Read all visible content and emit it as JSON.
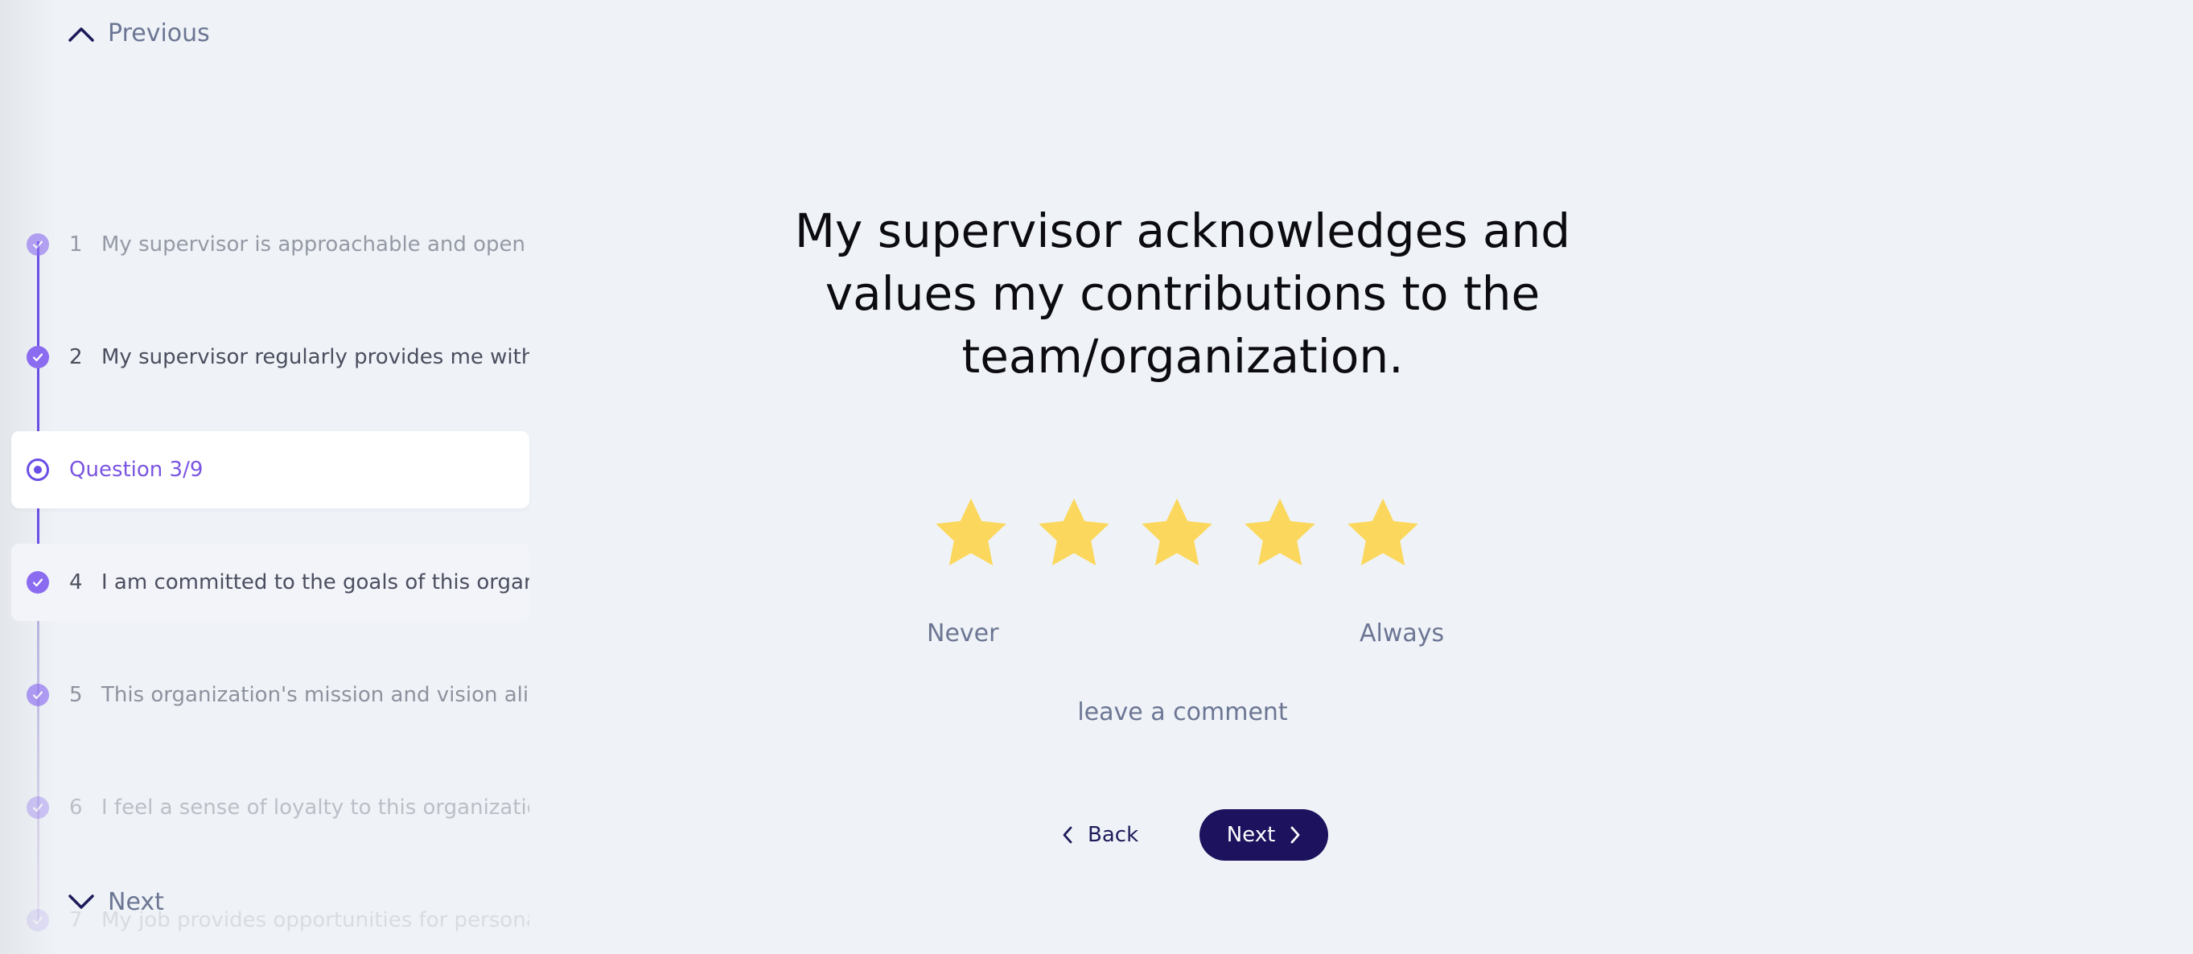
{
  "nav": {
    "previous_label": "Previous",
    "next_label": "Next"
  },
  "sidebar": {
    "current_label": "Question 3/9",
    "items": [
      {
        "number": "1",
        "text": "My supervisor is approachable and open to c",
        "status": "answered"
      },
      {
        "number": "2",
        "text": "My supervisor regularly provides me with cor",
        "status": "answered"
      },
      {
        "number": "3",
        "text": "",
        "status": "current"
      },
      {
        "number": "4",
        "text": "I am committed to the goals of this organiza",
        "status": "answered"
      },
      {
        "number": "5",
        "text": "This organization's mission and vision align v",
        "status": "answered"
      },
      {
        "number": "6",
        "text": "I feel a sense of loyalty to this organization's",
        "status": "answered"
      },
      {
        "number": "7",
        "text": "My job provides opportunities for personal ar",
        "status": "answered"
      }
    ]
  },
  "question": {
    "title": "My supervisor acknowledges and values my contributions to the team/organization.",
    "rating": {
      "max": 5,
      "filled": 5,
      "star_color": "#fbd85d",
      "low_label": "Never",
      "high_label": "Always"
    },
    "comment_link": "leave a comment"
  },
  "buttons": {
    "back_label": "Back",
    "next_label": "Next"
  },
  "colors": {
    "background": "#eff3f7",
    "accent": "#6b4ee6",
    "primary_button": "#1c125e",
    "muted_text": "#6c7694"
  }
}
